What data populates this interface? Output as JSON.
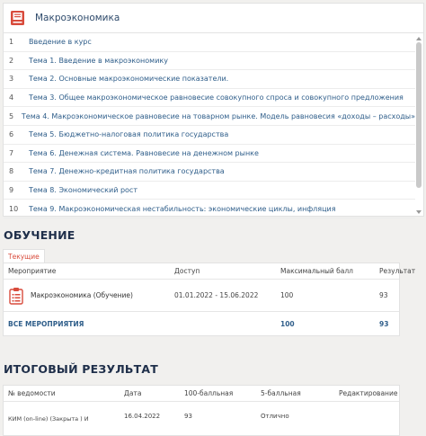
{
  "course": {
    "icon": "book-icon",
    "title": "Макроэкономика",
    "topics": [
      {
        "num": "1",
        "label": "Введение в курс"
      },
      {
        "num": "2",
        "label": "Тема 1. Введение в макроэкономику"
      },
      {
        "num": "3",
        "label": "Тема 2. Основные макроэкономические показатели."
      },
      {
        "num": "4",
        "label": "Тема 3. Общее макроэкономическое равновесие совокупного спроса и совокупного предложения"
      },
      {
        "num": "5",
        "label": "Тема 4. Макроэкономическое равновесие на товарном рынке. Модель равновесия «доходы – расходы»"
      },
      {
        "num": "6",
        "label": "Тема 5. Бюджетно-налоговая политика государства"
      },
      {
        "num": "7",
        "label": "Тема 6. Денежная система. Равновесие на денежном рынке"
      },
      {
        "num": "8",
        "label": "Тема 7. Денежно-кредитная политика государства"
      },
      {
        "num": "9",
        "label": "Тема 8. Экономический рост"
      },
      {
        "num": "10",
        "label": "Тема 9. Макроэкономическая нестабильность: экономические циклы, инфляция"
      }
    ]
  },
  "education": {
    "title": "ОБУЧЕНИЕ",
    "tab_current": "Текущие",
    "columns": {
      "event": "Мероприятие",
      "access": "Доступ",
      "max_score": "Максимальный балл",
      "result": "Результат"
    },
    "row": {
      "icon": "clipboard-icon",
      "event": "Макроэкономика (Обучение)",
      "access": "01.01.2022 - 15.06.2022",
      "max_score": "100",
      "result": "93"
    },
    "total": {
      "label": "ВСЕ МЕРОПРИЯТИЯ",
      "max_score": "100",
      "result": "93"
    }
  },
  "final": {
    "title": "ИТОГОВЫЙ РЕЗУЛЬТАТ",
    "columns": {
      "statement": "№ ведомости",
      "date": "Дата",
      "score100": "100-балльная",
      "score5": "5-балльная",
      "edit": "Редактирование"
    },
    "row": {
      "statement": "КИМ (on-line) (Закрыта ) И",
      "date": "16.04.2022",
      "score100": "93",
      "score5": "Отлично"
    }
  },
  "colors": {
    "accent": "#d84b3c",
    "link": "#2f5e8a",
    "heading": "#1f2f4a"
  }
}
